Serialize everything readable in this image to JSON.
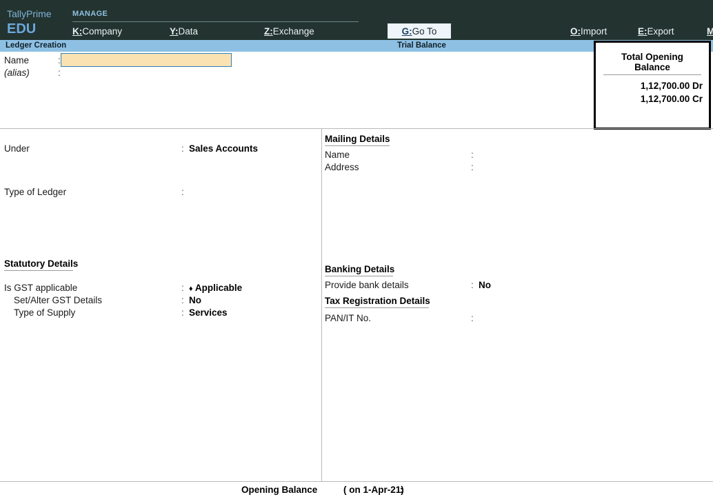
{
  "app": {
    "brand_name": "TallyPrime",
    "brand_edition": "EDU"
  },
  "topbar": {
    "section_label": "MANAGE",
    "menu_items": [
      {
        "key": "K:",
        "label": "Company"
      },
      {
        "key": "Y:",
        "label": "Data"
      },
      {
        "key": "Z:",
        "label": "Exchange"
      }
    ],
    "goto": {
      "key": "G:",
      "label": "Go To"
    },
    "right_items": [
      {
        "key": "O:",
        "label": "Import"
      },
      {
        "key": "E:",
        "label": "Export"
      },
      {
        "key": "M",
        "label": ""
      }
    ]
  },
  "titlebar": {
    "left_title": "Ledger Creation",
    "center_title": "Trial Balance"
  },
  "name_section": {
    "name_label": "Name",
    "name_colon": ":",
    "name_value": "",
    "alias_label": "(alias)",
    "alias_colon": ":",
    "alias_value": ""
  },
  "total_opening_balance": {
    "title": "Total Opening Balance",
    "debit": "1,12,700.00 Dr",
    "credit": "1,12,700.00 Cr"
  },
  "left_column": {
    "under": {
      "label": "Under",
      "colon": ":",
      "value": "Sales Accounts"
    },
    "type_of_ledger": {
      "label": "Type of Ledger",
      "colon": ":",
      "value": ""
    },
    "statutory_heading": "Statutory Details",
    "is_gst_applicable": {
      "label": "Is GST applicable",
      "colon": ":",
      "bullet": "♦",
      "value": "Applicable"
    },
    "set_alter_gst": {
      "label": "Set/Alter GST Details",
      "colon": ":",
      "value": "No"
    },
    "type_of_supply": {
      "label": "Type of Supply",
      "colon": ":",
      "value": "Services"
    }
  },
  "right_column": {
    "mailing_heading": "Mailing Details",
    "mailing_name": {
      "label": "Name",
      "colon": ":",
      "value": ""
    },
    "mailing_address": {
      "label": "Address",
      "colon": ":",
      "value": ""
    },
    "banking_heading": "Banking Details",
    "provide_bank_details": {
      "label": "Provide bank details",
      "colon": ":",
      "value": "No"
    },
    "tax_registration_heading": "Tax Registration Details",
    "pan_it_no": {
      "label": "PAN/IT No.",
      "colon": ":",
      "value": ""
    }
  },
  "footer": {
    "opening_balance_label": "Opening Balance",
    "opening_balance_date": "( on 1-Apr-21)",
    "opening_balance_colon": ":",
    "opening_balance_value": ""
  },
  "colors": {
    "topbar_bg": "#23332f",
    "accent_blue": "#6ca7dd",
    "title_bar_bg": "#8ec0e4",
    "input_fill": "#fae2b2",
    "input_border": "#2f7fb5",
    "box_border": "#000000"
  }
}
